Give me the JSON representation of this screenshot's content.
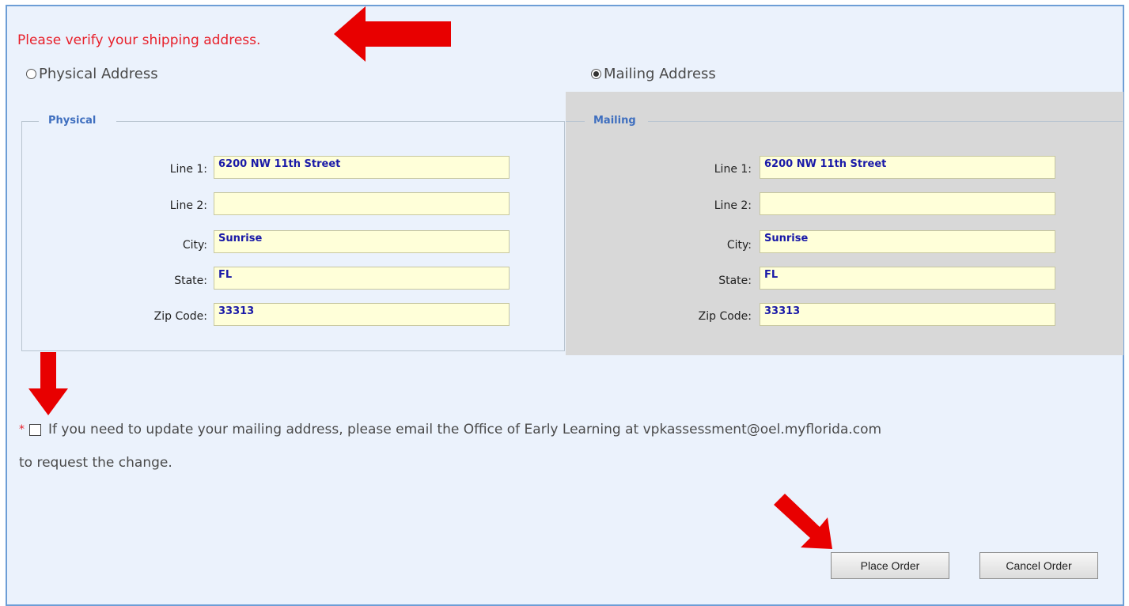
{
  "message": "Please verify your shipping address.",
  "options": {
    "physical": "Physical Address",
    "mailing": "Mailing Address",
    "selected": "mailing"
  },
  "physical": {
    "legend": "Physical",
    "labels": {
      "line1": "Line 1:",
      "line2": "Line 2:",
      "city": "City:",
      "state": "State:",
      "zip": "Zip Code:"
    },
    "values": {
      "line1": "6200 NW 11th Street",
      "line2": "",
      "city": "Sunrise",
      "state": "FL",
      "zip": "33313"
    }
  },
  "mailing": {
    "legend": "Mailing",
    "labels": {
      "line1": "Line 1:",
      "line2": "Line 2:",
      "city": "City:",
      "state": "State:",
      "zip": "Zip Code:"
    },
    "values": {
      "line1": "6200 NW 11th Street",
      "line2": "",
      "city": "Sunrise",
      "state": "FL",
      "zip": "33313"
    }
  },
  "note": {
    "required_mark": "*",
    "line1": "If you need to update your mailing address, please email the Office of Early Learning at vpkassessment@oel.myflorida.com",
    "line2": "to request the change.",
    "checked": false
  },
  "buttons": {
    "place_order": "Place Order",
    "cancel_order": "Cancel Order"
  },
  "colors": {
    "panel_bg": "#ebf2fc",
    "panel_border": "#6d9ed6",
    "error_text": "#e8202a",
    "legend": "#3f6fbf",
    "input_bg": "#ffffd9",
    "input_text": "#1a1aa8",
    "annotation_arrow": "#e80000"
  },
  "annotations": [
    "arrow-left-icon",
    "arrow-down-icon",
    "arrow-down-right-icon"
  ]
}
